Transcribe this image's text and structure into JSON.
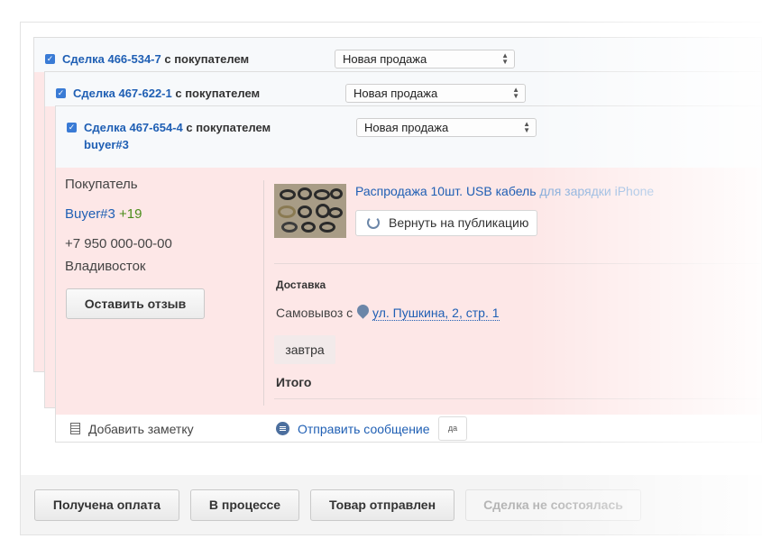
{
  "deals": [
    {
      "link": "Сделка 466-534-7",
      "suffix": " с покупателем",
      "status": "Новая продажа"
    },
    {
      "link": "Сделка 467-622-1",
      "suffix": " с покупателем",
      "status": "Новая продажа"
    },
    {
      "link": "Сделка 467-654-4",
      "suffix": " с покупателем",
      "buyer_line": "buyer#3",
      "status": "Новая продажа"
    }
  ],
  "buyer": {
    "label": "Покупатель",
    "name": "Buyer#3",
    "rating": "+19",
    "phone": "+7 950 000-00-00",
    "city": "Владивосток",
    "review_button": "Оставить отзыв"
  },
  "product": {
    "title_main": "Распродажа 10шт. USB кабель",
    "title_rest": " для зарядки iPhone",
    "return_button": "Вернуть на публикацию"
  },
  "delivery": {
    "label": "Доставка",
    "pickup_text": "Самовывоз с",
    "address": "ул. Пушкина, 2, стр. 1",
    "when": "завтра",
    "total_label": "Итого"
  },
  "footer": {
    "add_note": "Добавить заметку",
    "send_message": "Отправить сообщение",
    "yes_badge": "да"
  },
  "status_buttons": {
    "paid": "Получена оплата",
    "in_progress": "В процессе",
    "shipped": "Товар отправлен",
    "failed": "Сделка не состоялась"
  },
  "colors": {
    "link": "#1f5fb4",
    "rating": "#4a8c1a",
    "card_background": "#fde7e7",
    "checkbox": "#3a7bd5"
  }
}
